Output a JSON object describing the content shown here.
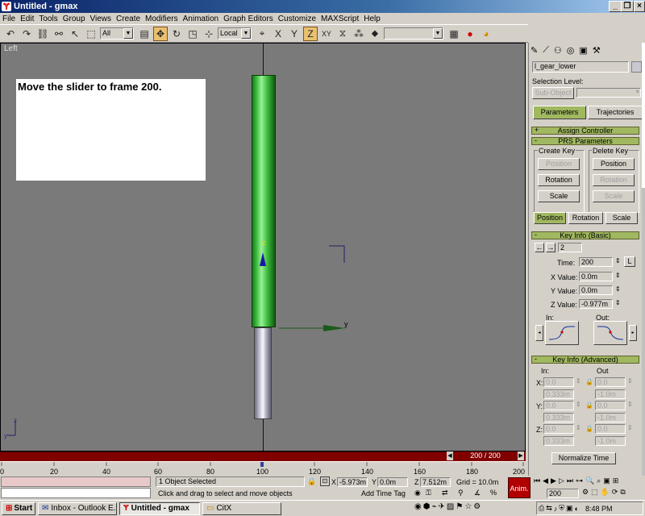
{
  "window": {
    "title": "Untitled - gmax"
  },
  "menu": [
    "File",
    "Edit",
    "Tools",
    "Group",
    "Views",
    "Create",
    "Modifiers",
    "Animation",
    "Graph Editors",
    "Customize",
    "MAXScript",
    "Help"
  ],
  "toolbar": {
    "selection_filter": "All",
    "coord_system": "Local"
  },
  "viewport": {
    "label": "Left",
    "instruction": "Move the slider to frame 200.",
    "axis_z": "z",
    "axis_y": "y"
  },
  "timeslider": {
    "text": "200 / 200",
    "ticks": [
      "0",
      "20",
      "40",
      "60",
      "80",
      "100",
      "120",
      "140",
      "160",
      "180",
      "200"
    ]
  },
  "command_panel": {
    "object_name": "l_gear_lower",
    "selection_level_label": "Selection Level:",
    "sub_object": "Sub-Object",
    "tabs": [
      "Parameters",
      "Trajectories"
    ],
    "assign_controller": "Assign Controller",
    "prs_parameters": "PRS Parameters",
    "create_key_label": "Create Key",
    "delete_key_label": "Delete Key",
    "create_key_buttons": [
      "Position",
      "Rotation",
      "Scale"
    ],
    "delete_key_buttons": [
      "Position",
      "Rotation",
      "Scale"
    ],
    "prs_tabs": [
      "Position",
      "Rotation",
      "Scale"
    ],
    "key_info_basic": "Key Info (Basic)",
    "key_number": "2",
    "time_label": "Time:",
    "time_value": "200",
    "lock_label": "L",
    "xvalue_label": "X Value:",
    "xvalue": "0.0m",
    "yvalue_label": "Y Value:",
    "yvalue": "0.0m",
    "zvalue_label": "Z Value:",
    "zvalue": "-0.977m",
    "in_label": "In:",
    "out_label": "Out:",
    "key_info_advanced": "Key Info (Advanced)",
    "adv_in": "In:",
    "adv_out": "Out",
    "adv_x": "X:",
    "adv_y": "Y:",
    "adv_z": "Z:",
    "adv_rows": [
      {
        "in": "0.0",
        "out": "0.0"
      },
      {
        "in": "0.333m",
        "out": "-1.0m"
      },
      {
        "in": "0.0",
        "out": "0.0"
      },
      {
        "in": "0.333m",
        "out": "-1.0m"
      },
      {
        "in": "0.0",
        "out": "0.0"
      },
      {
        "in": "0.333m",
        "out": "-1.0m"
      }
    ],
    "normalize_time": "Normalize Time"
  },
  "status": {
    "objects_selected": "1 Object Selected",
    "prompt": "Click and drag to select and move objects",
    "x_label": "X",
    "x": "-5.973m",
    "y_label": "Y",
    "y": "0.0m",
    "z_label": "Z",
    "z": "7.512m",
    "grid": "Grid = 10.0m",
    "add_time_tag": "Add Time Tag",
    "anim": "Anim.",
    "frame": "200"
  },
  "taskbar": {
    "start": "Start",
    "tasks": [
      "Inbox - Outlook E...",
      "Untitled - gmax",
      "CitX"
    ],
    "clock": "8:48 PM"
  }
}
